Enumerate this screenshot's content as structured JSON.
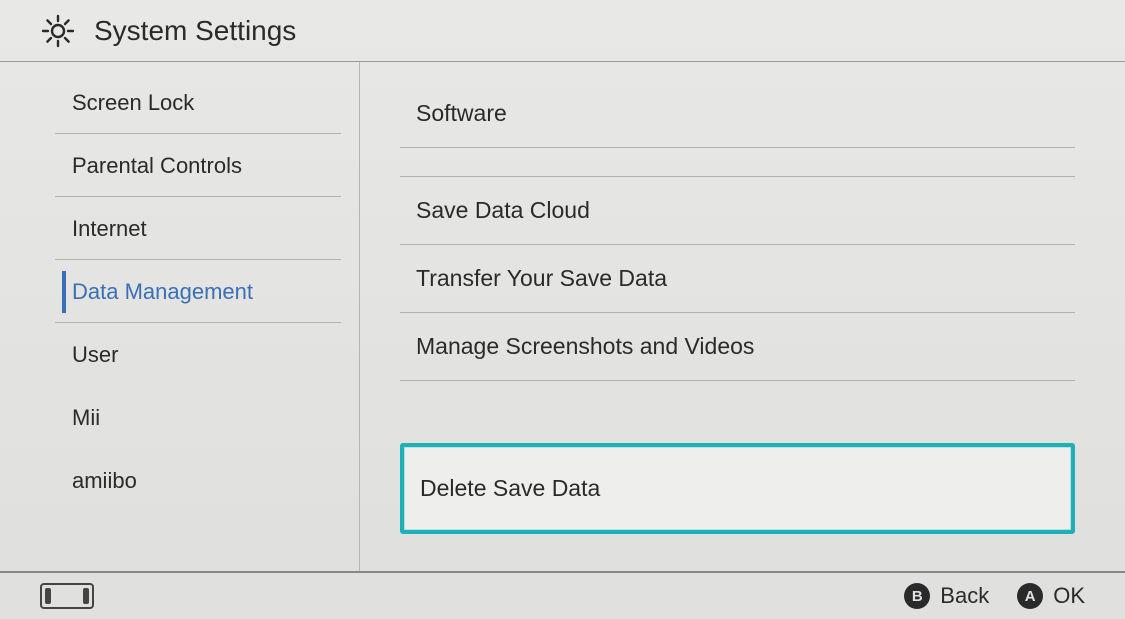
{
  "header": {
    "title": "System Settings"
  },
  "sidebar": {
    "items": [
      {
        "label": "Screen Lock",
        "active": false
      },
      {
        "label": "Parental Controls",
        "active": false
      },
      {
        "label": "Internet",
        "active": false
      },
      {
        "label": "Data Management",
        "active": true
      },
      {
        "label": "User",
        "active": false
      },
      {
        "label": "Mii",
        "active": false
      },
      {
        "label": "amiibo",
        "active": false
      }
    ]
  },
  "content": {
    "items": [
      {
        "label": "Software"
      },
      {
        "label": "Save Data Cloud"
      },
      {
        "label": "Transfer Your Save Data"
      },
      {
        "label": "Manage Screenshots and Videos"
      },
      {
        "label": "Delete Save Data"
      }
    ]
  },
  "footer": {
    "back": {
      "glyph": "B",
      "label": "Back"
    },
    "ok": {
      "glyph": "A",
      "label": "OK"
    }
  }
}
